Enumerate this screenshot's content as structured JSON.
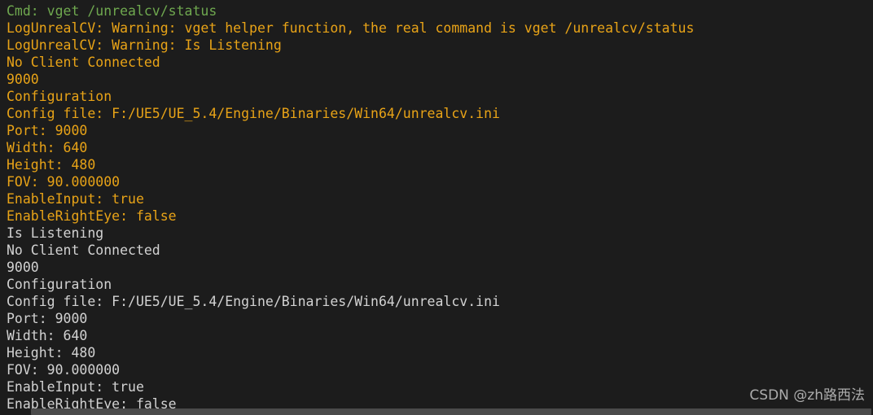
{
  "console": {
    "background_color": "#1c1c1c",
    "clipped_top_line": "LogUnrealCV: Warning: vget helper function, the real command is vget /unrealcv/status",
    "colors": {
      "command": "#6fa84f",
      "warning": "#e8a317",
      "plain": "#d2d2d2",
      "scrollbar_track": "#3a3a3a",
      "scrollbar_thumb": "#4a4a4a"
    },
    "lines": [
      {
        "text": "Cmd: vget /unrealcv/status",
        "style": "cmd"
      },
      {
        "text": "LogUnrealCV: Warning: vget helper function, the real command is vget /unrealcv/status",
        "style": "warn"
      },
      {
        "text": "LogUnrealCV: Warning: Is Listening",
        "style": "warn"
      },
      {
        "text": "No Client Connected",
        "style": "warn"
      },
      {
        "text": "9000",
        "style": "warn"
      },
      {
        "text": "Configuration",
        "style": "warn"
      },
      {
        "text": "Config file: F:/UE5/UE_5.4/Engine/Binaries/Win64/unrealcv.ini",
        "style": "warn"
      },
      {
        "text": "Port: 9000",
        "style": "warn"
      },
      {
        "text": "Width: 640",
        "style": "warn"
      },
      {
        "text": "Height: 480",
        "style": "warn"
      },
      {
        "text": "FOV: 90.000000",
        "style": "warn"
      },
      {
        "text": "EnableInput: true",
        "style": "warn"
      },
      {
        "text": "EnableRightEye: false",
        "style": "warn"
      },
      {
        "text": "Is Listening",
        "style": "plain"
      },
      {
        "text": "No Client Connected",
        "style": "plain"
      },
      {
        "text": "9000",
        "style": "plain"
      },
      {
        "text": "Configuration",
        "style": "plain"
      },
      {
        "text": "Config file: F:/UE5/UE_5.4/Engine/Binaries/Win64/unrealcv.ini",
        "style": "plain"
      },
      {
        "text": "Port: 9000",
        "style": "plain"
      },
      {
        "text": "Width: 640",
        "style": "plain"
      },
      {
        "text": "Height: 480",
        "style": "plain"
      },
      {
        "text": "FOV: 90.000000",
        "style": "plain"
      },
      {
        "text": "EnableInput: true",
        "style": "plain"
      },
      {
        "text": "EnableRightEye: false",
        "style": "plain"
      }
    ]
  },
  "watermark": {
    "text": "CSDN @zh路西法"
  }
}
